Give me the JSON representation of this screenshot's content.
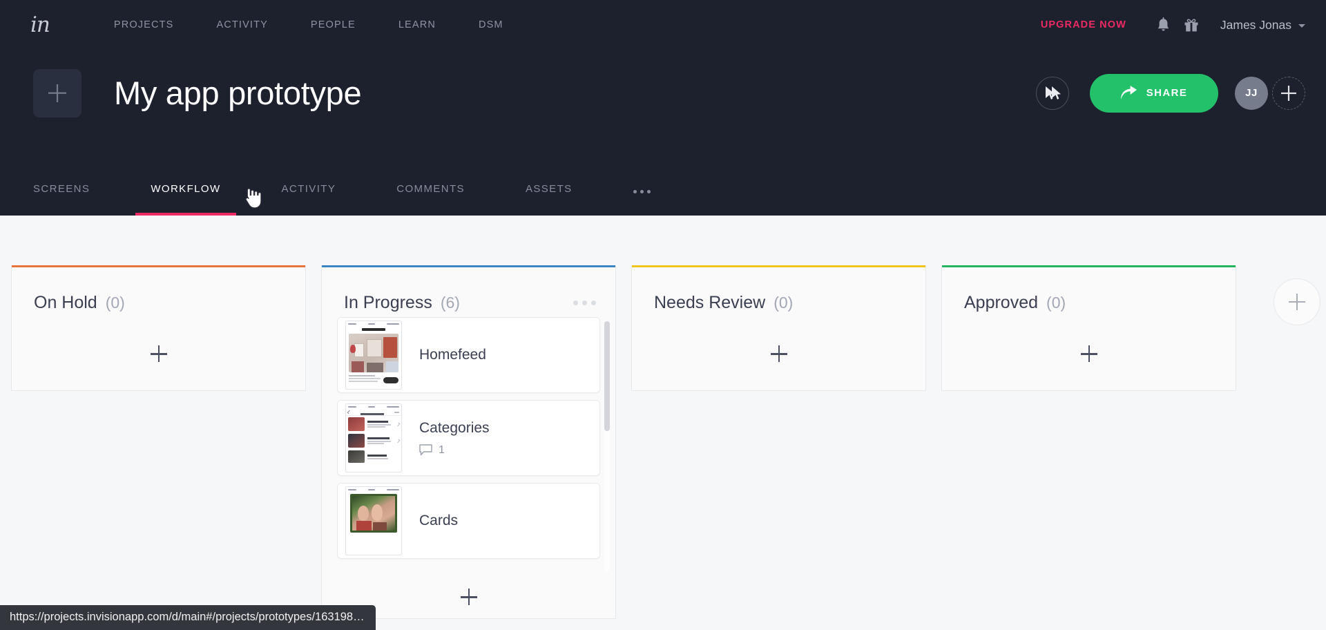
{
  "topbar": {
    "logo": "in",
    "nav": [
      {
        "label": "PROJECTS"
      },
      {
        "label": "ACTIVITY"
      },
      {
        "label": "PEOPLE"
      },
      {
        "label": "LEARN"
      },
      {
        "label": "DSM"
      }
    ],
    "upgrade_label": "UPGRADE NOW",
    "upgrade_color": "#ed2a63",
    "notifications_icon": "bell-icon",
    "gifts_icon": "gift-icon",
    "user_name": "James Jonas"
  },
  "project": {
    "title": "My app prototype",
    "add_thumbnail_icon": "plus-icon",
    "preview_icon": "play-cursor-icon",
    "share_label": "SHARE",
    "share_color": "#24c16b",
    "share_icon": "share-arrow-icon",
    "avatar_initials": "JJ",
    "add_member_icon": "plus-icon"
  },
  "tabs": [
    {
      "label": "SCREENS",
      "active": false
    },
    {
      "label": "WORKFLOW",
      "active": true
    },
    {
      "label": "ACTIVITY",
      "active": false
    },
    {
      "label": "COMMENTS",
      "active": false
    },
    {
      "label": "ASSETS",
      "active": false
    }
  ],
  "tabs_overflow_icon": "ellipsis-icon",
  "active_tab_underline_color": "#ed2a63",
  "board": {
    "add_column_icon": "plus-icon",
    "columns": [
      {
        "title": "On Hold",
        "count": "(0)",
        "accent": "#e8743b",
        "has_menu": false,
        "cards": []
      },
      {
        "title": "In Progress",
        "count": "(6)",
        "accent": "#3b84c4",
        "has_menu": true,
        "menu_icon": "ellipsis-icon",
        "scroll_position_percent": 0,
        "cards": [
          {
            "title": "Homefeed",
            "comments": null,
            "thumb": "touchnote-homefeed"
          },
          {
            "title": "Categories",
            "comments": "1",
            "comment_icon": "comment-icon",
            "thumb": "christmas-range-list"
          },
          {
            "title": "Cards",
            "comments": null,
            "thumb": "kids-photo-card"
          }
        ]
      },
      {
        "title": "Needs Review",
        "count": "(0)",
        "accent": "#f0c41b",
        "has_menu": false,
        "cards": []
      },
      {
        "title": "Approved",
        "count": "(0)",
        "accent": "#22b45f",
        "has_menu": false,
        "cards": []
      }
    ]
  },
  "status_bar": {
    "url": "https://projects.invisionapp.com/d/main#/projects/prototypes/163198…"
  }
}
